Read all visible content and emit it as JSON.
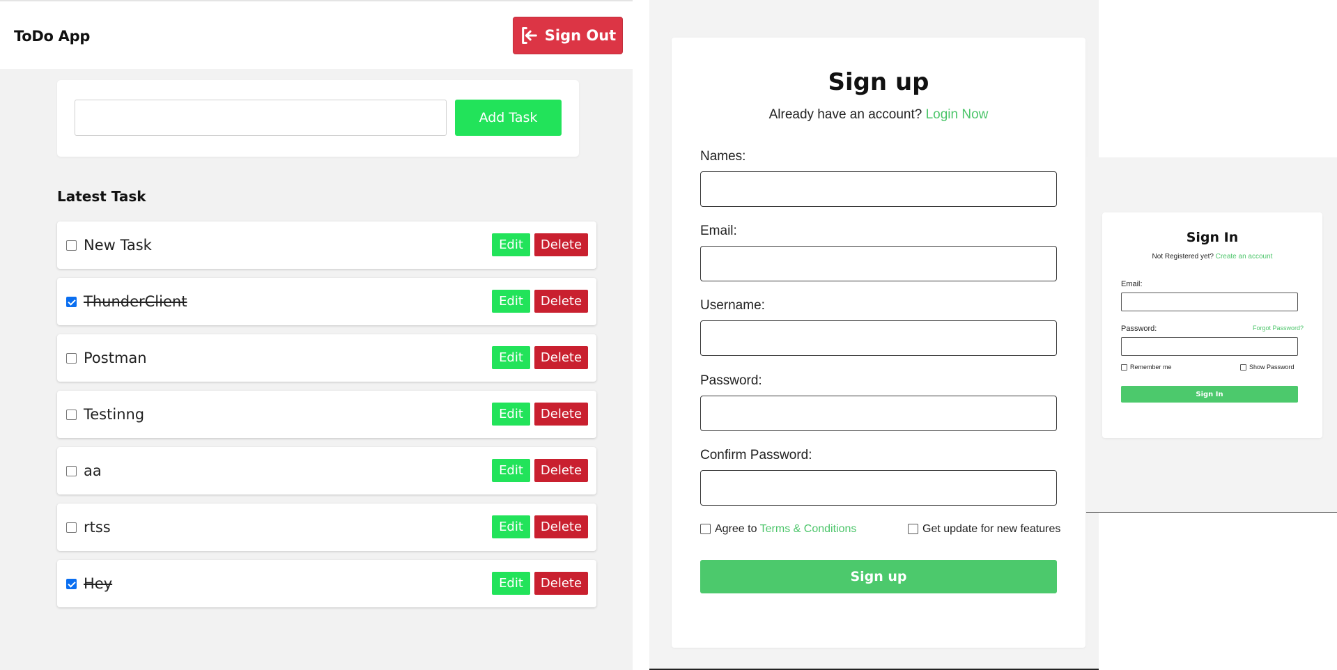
{
  "todo": {
    "app_title": "ToDo App",
    "signout_label": "Sign Out",
    "task_input_value": "",
    "add_label": "Add Task",
    "section_title": "Latest Task",
    "edit_label": "Edit",
    "delete_label": "Delete",
    "tasks": [
      {
        "label": "New Task",
        "done": false
      },
      {
        "label": "ThunderClient",
        "done": true
      },
      {
        "label": "Postman",
        "done": false
      },
      {
        "label": "Testinng",
        "done": false
      },
      {
        "label": "aa",
        "done": false
      },
      {
        "label": "rtss",
        "done": false
      },
      {
        "label": "Hey",
        "done": true
      }
    ]
  },
  "signup": {
    "title": "Sign up",
    "subtitle": "Already have an account?",
    "login_link": "Login Now",
    "fields": [
      "Names:",
      "Email:",
      "Username:",
      "Password:",
      "Confirm Password:"
    ],
    "agree_prefix": "Agree to",
    "terms_link": "Terms & Conditions",
    "updates_label": "Get update for new features",
    "submit_label": "Sign up"
  },
  "signin": {
    "title": "Sign In",
    "subtitle": "Not Registered yet?",
    "create_link": "Create an account",
    "email_label": "Email:",
    "password_label": "Password:",
    "forgot_link": "Forgot Password?",
    "remember_label": "Remember me",
    "show_label": "Show Password",
    "submit_label": "Sign In"
  },
  "colors": {
    "accent_green": "#22e35a",
    "form_green": "#4cc96c",
    "danger_red": "#dc3545",
    "checkbox_blue": "#0a6ef0"
  }
}
